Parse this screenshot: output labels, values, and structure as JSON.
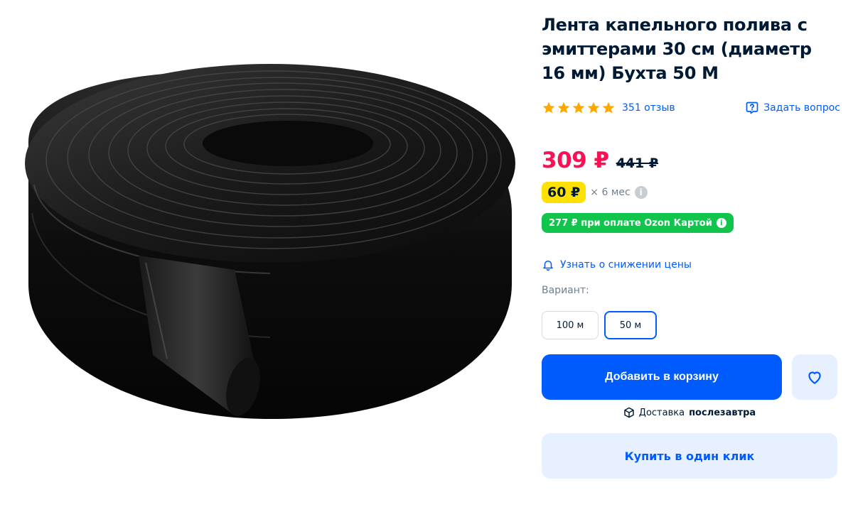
{
  "product": {
    "title": "Лента капельного полива с эмиттерами 30 см (диаметр 16 мм) Бухта 50 М",
    "image_icon": "drip-tape-coil-image"
  },
  "rating": {
    "stars": 5,
    "reviews_label": "351 отзыв",
    "ask_label": "Задать вопрос"
  },
  "price": {
    "current": "309 ₽",
    "old": "441 ₽",
    "installment_amount": "60 ₽",
    "installment_term": "× 6 мес",
    "ozon_card_offer": "277 ₽ при оплате Ozon Картой"
  },
  "price_alert_label": "Узнать о снижении цены",
  "variant": {
    "label": "Вариант:",
    "options": [
      "100 м",
      "50 м"
    ],
    "selected": "50 м"
  },
  "actions": {
    "add_to_cart": "Добавить в корзину",
    "delivery_prefix": "Доставка",
    "delivery_when": "послезавтра",
    "buy_one_click": "Купить в один клик"
  },
  "colors": {
    "accent": "#005bff",
    "price": "#f91155",
    "installment_badge": "#ffe100",
    "ozon_badge": "#10c44c",
    "star": "#ffa800"
  }
}
